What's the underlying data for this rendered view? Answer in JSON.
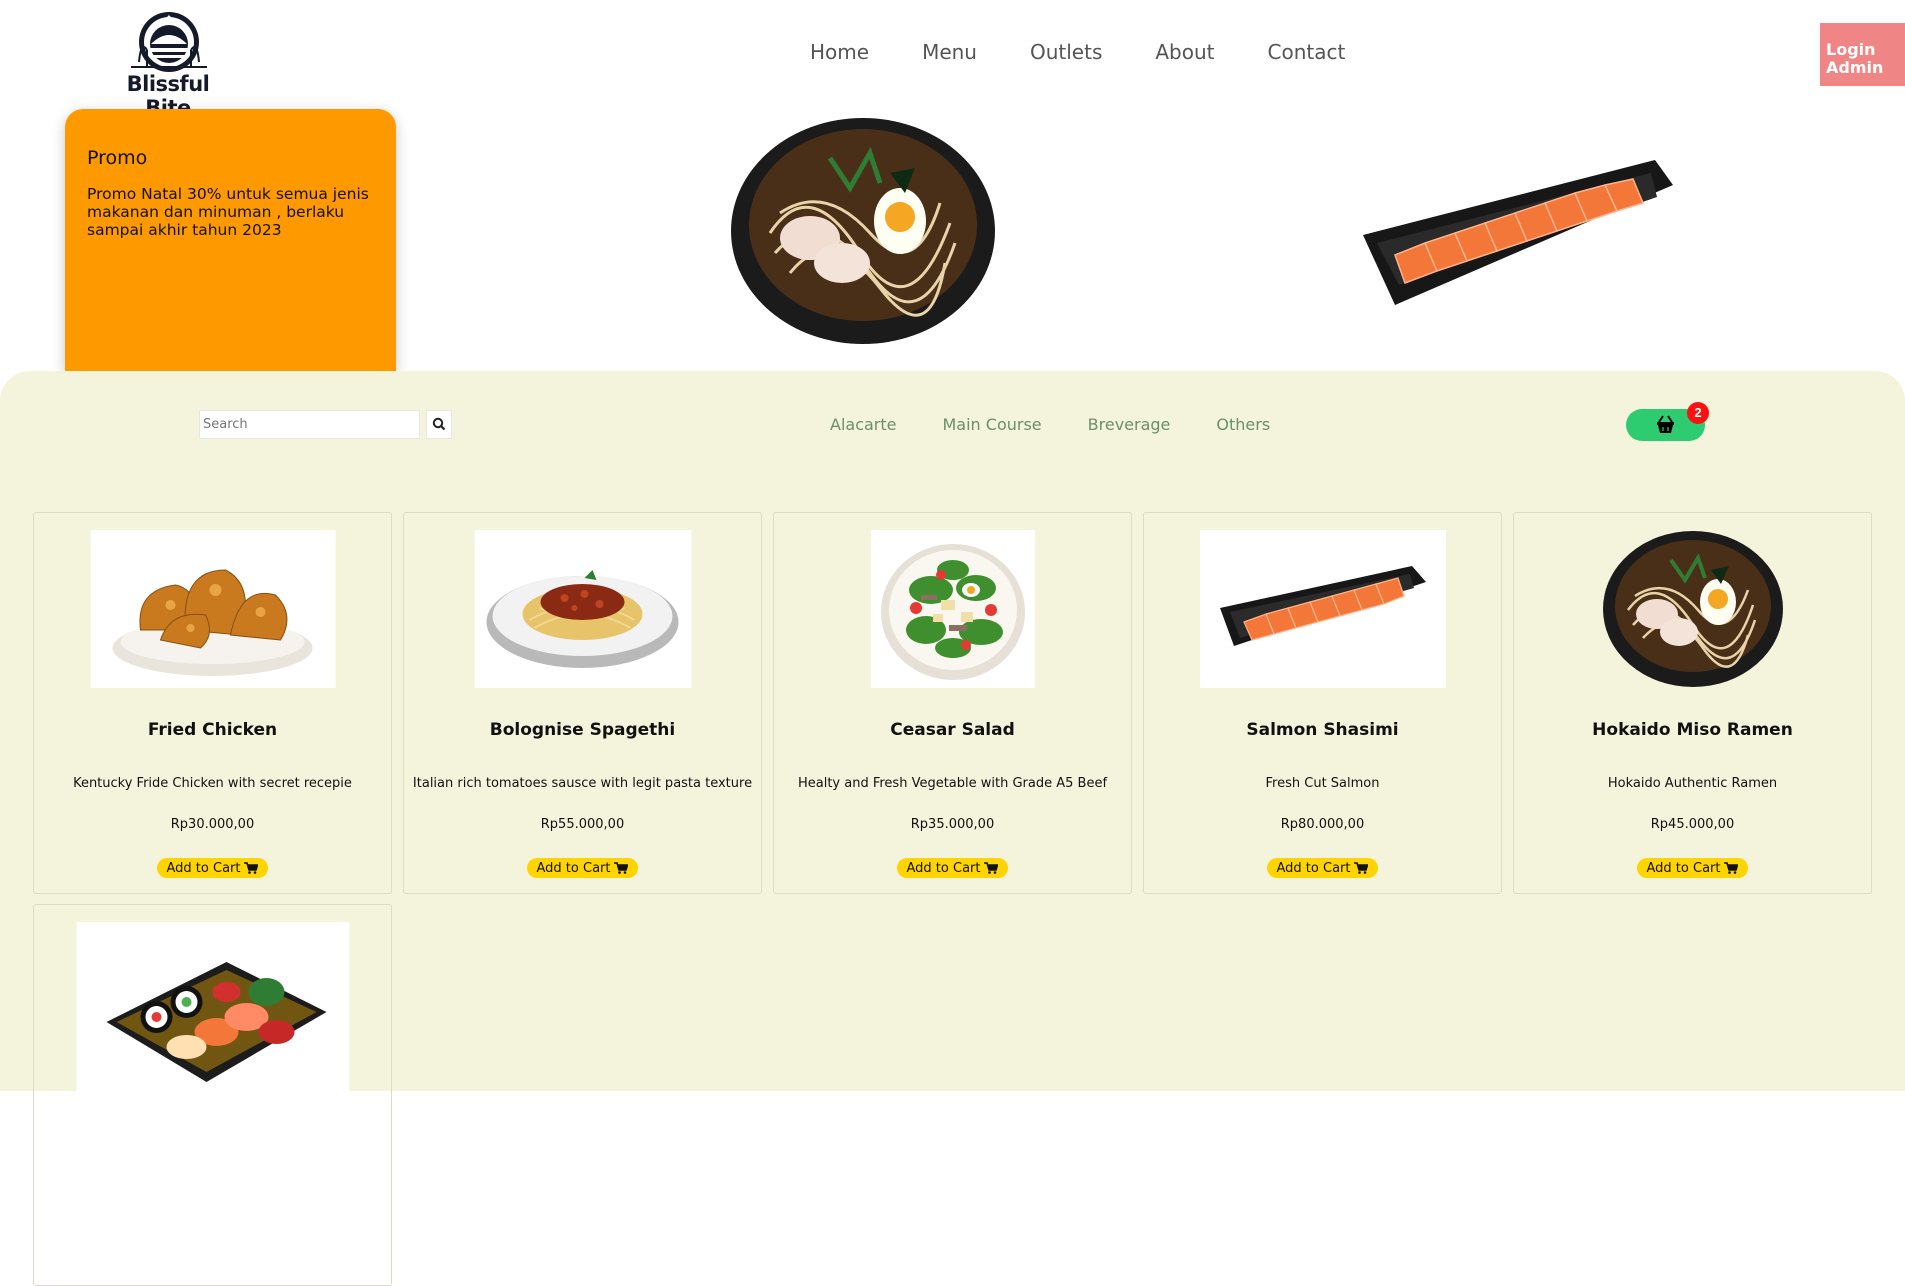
{
  "brand": {
    "name": "Blissful Bite"
  },
  "nav": [
    "Home",
    "Menu",
    "Outlets",
    "About",
    "Contact"
  ],
  "login": {
    "label": "Login Admin"
  },
  "promo": {
    "title": "Promo",
    "text": "Promo Natal 30% untuk semua jenis makanan dan minuman , berlaku sampai akhir tahun 2023"
  },
  "search": {
    "placeholder": "Search"
  },
  "categories": [
    "Alacarte",
    "Main Course",
    "Breverage",
    "Others"
  ],
  "cart": {
    "count": "2"
  },
  "products": [
    {
      "name": "Fried Chicken",
      "desc": "Kentucky Fride Chicken with secret recepie",
      "price": "Rp30.000,00",
      "button": "Add to Cart",
      "icon": "fried-chicken"
    },
    {
      "name": "Bolognise Spagethi",
      "desc": "Italian rich tomatoes sausce with legit pasta texture",
      "price": "Rp55.000,00",
      "button": "Add to Cart",
      "icon": "spaghetti"
    },
    {
      "name": "Ceasar Salad",
      "desc": "Healty and Fresh Vegetable with Grade A5 Beef",
      "price": "Rp35.000,00",
      "button": "Add to Cart",
      "icon": "salad"
    },
    {
      "name": "Salmon Shasimi",
      "desc": "Fresh Cut Salmon",
      "price": "Rp80.000,00",
      "button": "Add to Cart",
      "icon": "salmon-sashimi"
    },
    {
      "name": "Hokaido Miso Ramen",
      "desc": "Hokaido Authentic Ramen",
      "price": "Rp45.000,00",
      "button": "Add to Cart",
      "icon": "ramen"
    },
    {
      "name": "",
      "desc": "",
      "price": "",
      "button": "",
      "icon": "sushi-platter"
    }
  ],
  "colors": {
    "promo": "#ff9900",
    "panel": "#f4f3dc",
    "login": "#f08585",
    "cart": "#2ecc71",
    "add_button": "#ffd400",
    "category_text": "#6b8f6b"
  }
}
